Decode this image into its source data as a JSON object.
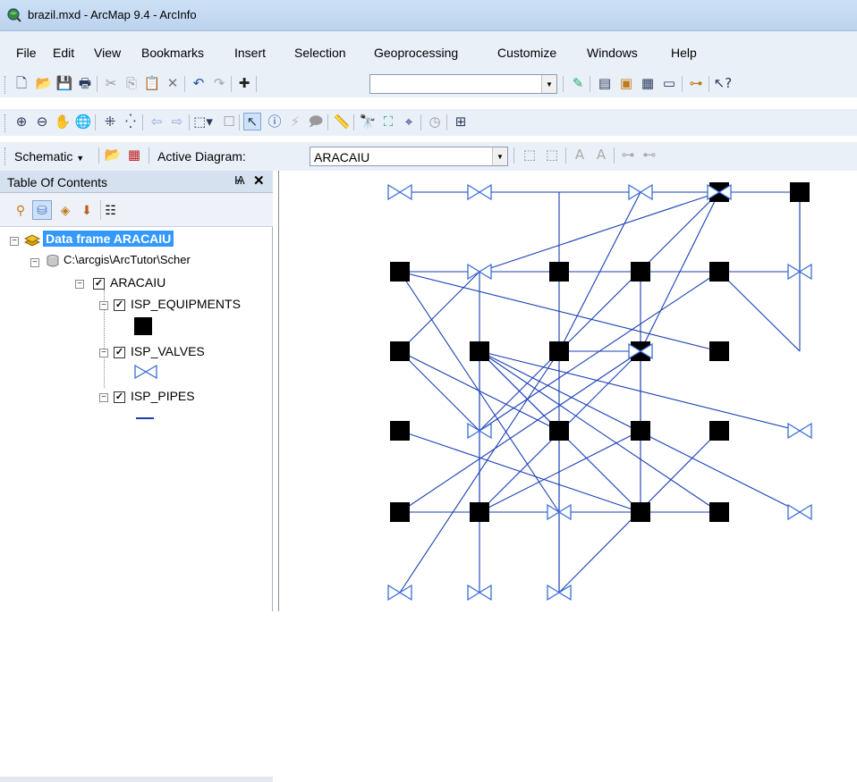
{
  "window": {
    "title": "brazil.mxd - ArcMap 9.4 - ArcInfo",
    "icon": "arcmap-globe-icon"
  },
  "menu": [
    "File",
    "Edit",
    "View",
    "Bookmarks",
    "Insert",
    "Selection",
    "Geoprocessing",
    "Customize",
    "Windows",
    "Help"
  ],
  "schematic_toolbar": {
    "schematic_label": "Schematic",
    "active_diagram_label": "Active Diagram:",
    "active_diagram_value": "ARACAIU"
  },
  "toc": {
    "title": "Table Of Contents",
    "pin_glyph": "Ѩ",
    "close_glyph": "✕",
    "data_frame": "Data frame ARACAIU",
    "path": "C:\\arcgis\\ArcTutor\\Scher",
    "dataset": "ARACAIU",
    "layers": [
      "ISP_EQUIPMENTS",
      "ISP_VALVES",
      "ISP_PIPES"
    ]
  },
  "colors": {
    "pipe": "#1a3fb5",
    "valve": "#3a6fd8",
    "equipment": "#000000",
    "selection": "#3399ff"
  },
  "diagram": {
    "equipments": [
      [
        5,
        1
      ],
      [
        8,
        1
      ],
      [
        1,
        2
      ],
      [
        3,
        2
      ],
      [
        4,
        2
      ],
      [
        5,
        2
      ],
      [
        1,
        3
      ],
      [
        2,
        3
      ],
      [
        3,
        3
      ],
      [
        6,
        3
      ],
      [
        7,
        3
      ],
      [
        1,
        4
      ],
      [
        3,
        4
      ],
      [
        4,
        4
      ],
      [
        5,
        4
      ],
      [
        1,
        5
      ],
      [
        2,
        5
      ],
      [
        4,
        5
      ],
      [
        5,
        5
      ]
    ],
    "valves": [
      [
        1,
        1
      ],
      [
        2,
        1
      ],
      [
        6,
        1
      ],
      [
        7,
        1
      ],
      [
        2,
        2
      ],
      [
        8,
        2
      ],
      [
        4,
        3
      ],
      [
        2,
        4
      ],
      [
        8,
        4
      ],
      [
        3,
        5
      ],
      [
        8,
        5
      ],
      [
        1,
        6
      ],
      [
        2,
        6
      ],
      [
        3,
        6
      ]
    ],
    "pipes": [
      [
        1,
        1,
        8,
        1
      ],
      [
        2,
        2,
        8,
        2
      ],
      [
        8,
        1,
        8,
        2
      ],
      [
        1,
        2,
        2,
        2
      ],
      [
        3,
        3,
        4,
        3
      ],
      [
        1,
        5,
        5,
        5
      ],
      [
        3,
        1,
        3,
        6
      ],
      [
        5,
        1,
        2,
        2
      ],
      [
        7,
        1,
        2,
        4
      ],
      [
        8,
        1,
        8,
        3
      ],
      [
        6,
        1,
        3,
        3
      ],
      [
        7,
        1,
        4,
        3
      ],
      [
        5,
        2,
        8,
        3
      ],
      [
        1,
        2,
        7,
        3
      ],
      [
        1,
        2,
        3,
        5
      ],
      [
        2,
        2,
        2,
        5
      ],
      [
        2,
        2,
        1,
        3
      ],
      [
        5,
        2,
        2,
        4
      ],
      [
        4,
        2,
        4,
        4
      ],
      [
        1,
        3,
        2,
        4
      ],
      [
        2,
        3,
        8,
        4
      ],
      [
        2,
        3,
        8,
        5
      ],
      [
        2,
        3,
        5,
        5
      ],
      [
        2,
        3,
        4,
        5
      ],
      [
        2,
        3,
        2,
        6
      ],
      [
        2,
        3,
        3,
        4
      ],
      [
        1,
        3,
        3,
        4
      ],
      [
        3,
        3,
        1,
        6
      ],
      [
        6,
        3,
        1,
        5
      ],
      [
        6,
        3,
        2,
        5
      ],
      [
        3,
        4,
        3,
        6
      ],
      [
        1,
        4,
        4,
        5
      ],
      [
        5,
        4,
        3,
        6
      ],
      [
        4,
        4,
        2,
        5
      ],
      [
        6,
        3,
        4,
        5
      ]
    ]
  }
}
